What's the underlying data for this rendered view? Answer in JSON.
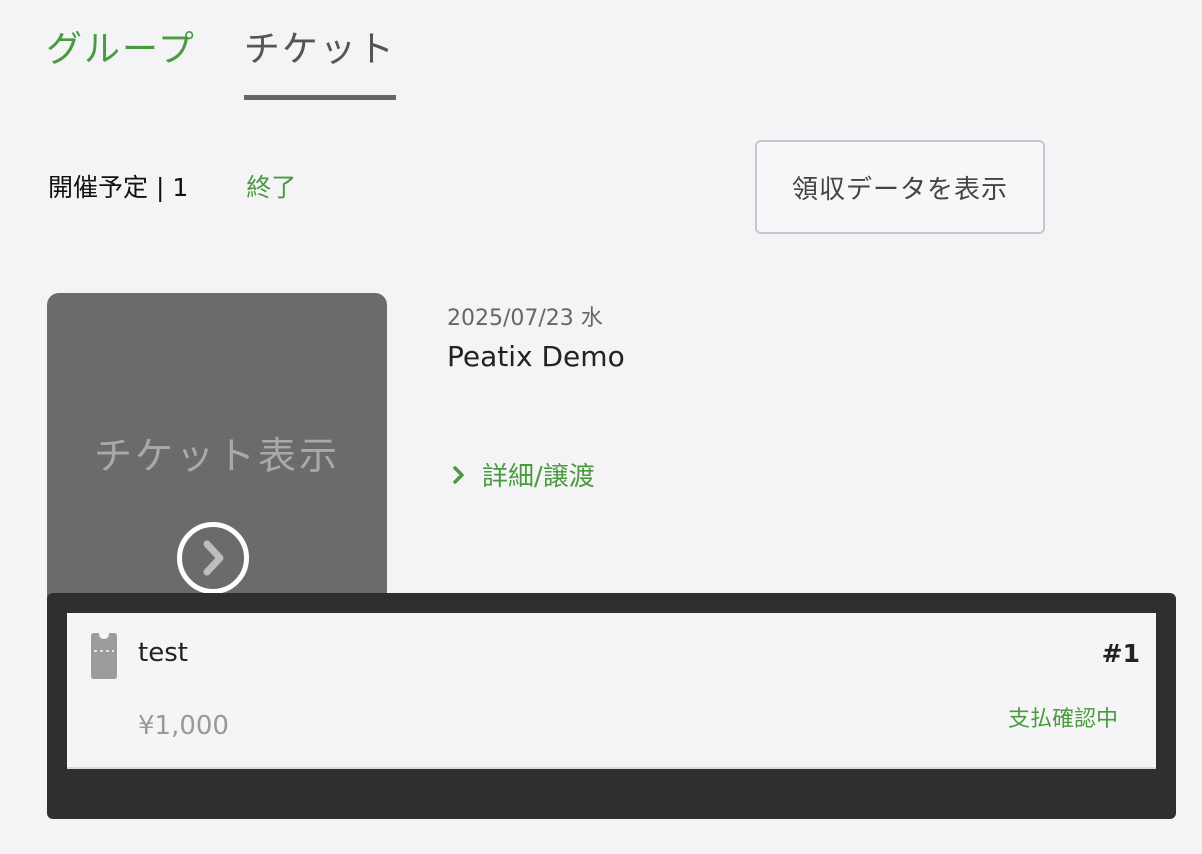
{
  "tabs": [
    {
      "label": "グループ",
      "active": false
    },
    {
      "label": "チケット",
      "active": true
    }
  ],
  "filters": {
    "upcoming_label": "開催予定 | 1",
    "ended_label": "終了"
  },
  "receipt_button": {
    "label": "領収データを表示"
  },
  "event": {
    "date": "2025/07/23 水",
    "title": "Peatix Demo",
    "thumbnail_label": "チケット表示",
    "detail_link": "詳細/譲渡"
  },
  "ticket": {
    "name": "test",
    "number": "#1",
    "price": "¥1,000",
    "status": "支払確認中"
  },
  "colors": {
    "accent_green": "#4a9a3f",
    "background": "#f4f4f7",
    "overlay": "#2f2f2f"
  }
}
